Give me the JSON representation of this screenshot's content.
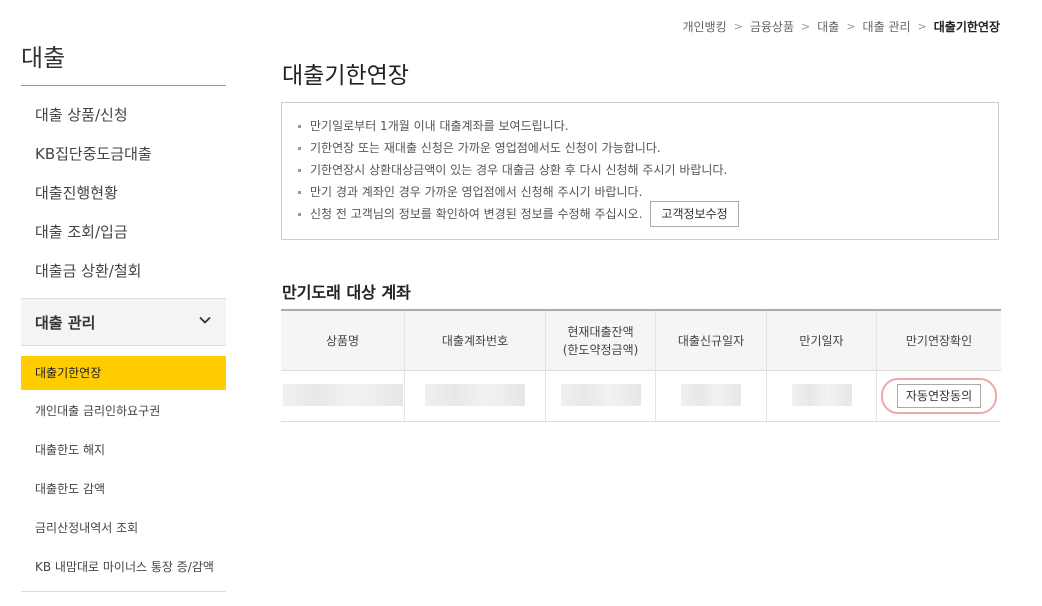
{
  "breadcrumb": [
    "개인뱅킹",
    "금융상품",
    "대출",
    "대출 관리",
    "대출기한연장"
  ],
  "sidebar": {
    "title": "대출",
    "items": [
      "대출 상품/신청",
      "KB집단중도금대출",
      "대출진행현황",
      "대출 조회/입금",
      "대출금 상환/철회"
    ],
    "group": {
      "label": "대출 관리",
      "icon": "chevron-down-icon",
      "sub_items": [
        "대출기한연장",
        "개인대출 금리인하요구권",
        "대출한도 해지",
        "대출한도 감액",
        "금리산정내역서 조회",
        "KB 내맘대로 마이너스 통장 증/감액"
      ]
    }
  },
  "main": {
    "title": "대출기한연장",
    "notices": [
      "만기일로부터 1개월 이내 대출계좌를 보여드립니다.",
      "기한연장 또는 재대출 신청은 가까운 영업점에서도 신청이 가능합니다.",
      "기한연장시 상환대상금액이 있는 경우 대출금 상환 후 다시 신청해 주시기 바랍니다.",
      "만기 경과 계좌인 경우 가까운 영업점에서 신청해 주시기 바랍니다.",
      "신청 전 고객님의 정보를 확인하여 변경된 정보를 수정해 주십시오."
    ],
    "customer_info_button": "고객정보수정",
    "section_title": "만기도래 대상 계좌",
    "table": {
      "headers": [
        "상품명",
        "대출계좌번호",
        "현재대출잔액",
        "(한도약정금액)",
        "대출신규일자",
        "만기일자",
        "만기연장확인"
      ],
      "agree_button": "자동연장동의"
    }
  },
  "colors": {
    "accent": "#ffcc00",
    "highlight_ring": "#f0a6ad"
  }
}
